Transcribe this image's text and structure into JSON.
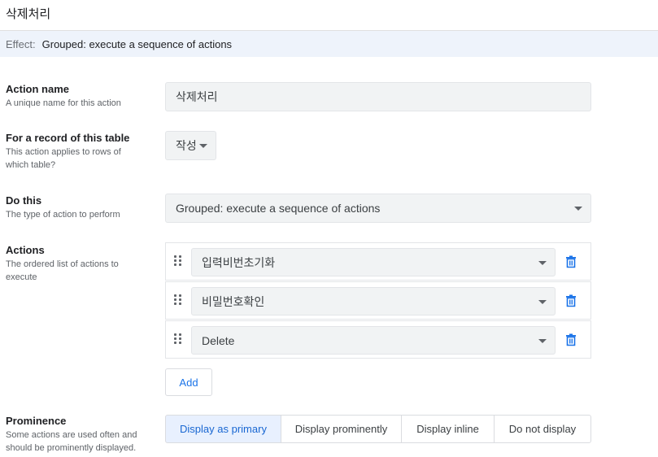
{
  "header": {
    "title": "삭제처리"
  },
  "effect": {
    "label": "Effect:",
    "value": "Grouped: execute a sequence of actions"
  },
  "action_name": {
    "title": "Action name",
    "desc": "A unique name for this action",
    "value": "삭제처리"
  },
  "table": {
    "title": "For a record of this table",
    "desc_1": "This action applies to rows of",
    "desc_2": "which table?",
    "value": "작성"
  },
  "do_this": {
    "title": "Do this",
    "desc": "The type of action to perform",
    "value": "Grouped: execute a sequence of actions"
  },
  "actions": {
    "title": "Actions",
    "desc_1": "The ordered list of actions to",
    "desc_2": "execute",
    "items": [
      {
        "label": "입력비번초기화"
      },
      {
        "label": "비밀번호확인"
      },
      {
        "label": "Delete"
      }
    ],
    "add_label": "Add"
  },
  "prominence": {
    "title": "Prominence",
    "desc_1": "Some actions are used often and",
    "desc_2": "should be prominently displayed.",
    "options": [
      {
        "label": "Display as primary",
        "selected": true
      },
      {
        "label": "Display prominently",
        "selected": false
      },
      {
        "label": "Display inline",
        "selected": false
      },
      {
        "label": "Do not display",
        "selected": false
      }
    ]
  },
  "colors": {
    "accent": "#1a73e8",
    "effect_bg": "#eef3fb",
    "field_bg": "#f1f3f4",
    "selected_bg": "#e8f0fe"
  },
  "icons": {
    "drag": "drag-handle-icon",
    "delete": "trash-icon",
    "dropdown": "chevron-down-icon"
  }
}
